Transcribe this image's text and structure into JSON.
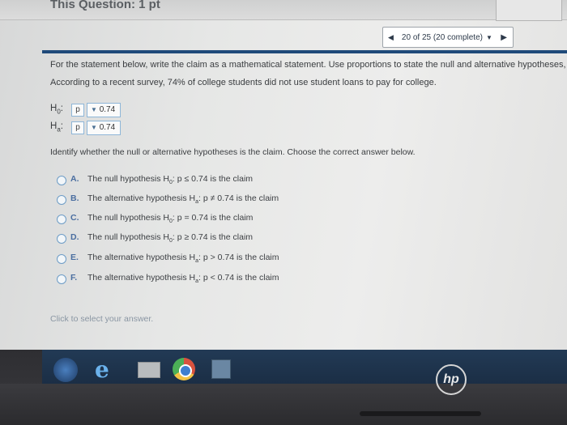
{
  "header": {
    "title": "This Question: 1 pt"
  },
  "progress": {
    "label": "20 of 25 (20 complete)",
    "prev_icon": "caret-left-icon",
    "next_icon": "caret-right-icon",
    "dropdown_icon": "caret-down-icon"
  },
  "question": {
    "instruction": "For the statement below, write the claim as a mathematical statement. Use proportions to state the null and alternative hypotheses, and identify whi",
    "statement": "According to a recent survey, 74% of college students did not use student loans to pay for college.",
    "h0": {
      "label": "H",
      "sub": "0",
      "var": "p",
      "value": "0.74"
    },
    "ha": {
      "label": "H",
      "sub": "a",
      "var": "p",
      "value": "0.74"
    },
    "identify_prompt": "Identify whether the null or alternative hypotheses is the claim. Choose the correct answer below."
  },
  "options": [
    {
      "letter": "A.",
      "text": "The null hypothesis H",
      "sub": "0",
      "rest": ": p ≤ 0.74 is the claim"
    },
    {
      "letter": "B.",
      "text": "The alternative hypothesis H",
      "sub": "a",
      "rest": ": p ≠ 0.74 is the claim"
    },
    {
      "letter": "C.",
      "text": "The null hypothesis H",
      "sub": "0",
      "rest": ": p = 0.74 is the claim"
    },
    {
      "letter": "D.",
      "text": "The null hypothesis H",
      "sub": "0",
      "rest": ": p ≥ 0.74 is the claim"
    },
    {
      "letter": "E.",
      "text": "The alternative hypothesis H",
      "sub": "a",
      "rest": ": p > 0.74 is the claim"
    },
    {
      "letter": "F.",
      "text": "The alternative hypothesis H",
      "sub": "a",
      "rest": ": p < 0.74 is the claim"
    }
  ],
  "footer": {
    "hint": "Click to select your answer."
  },
  "taskbar": {
    "start": "windows-start-icon",
    "ie": "internet-explorer-icon",
    "folder": "file-explorer-icon",
    "chrome": "chrome-icon",
    "media": "media-player-icon",
    "logo": "hp"
  }
}
